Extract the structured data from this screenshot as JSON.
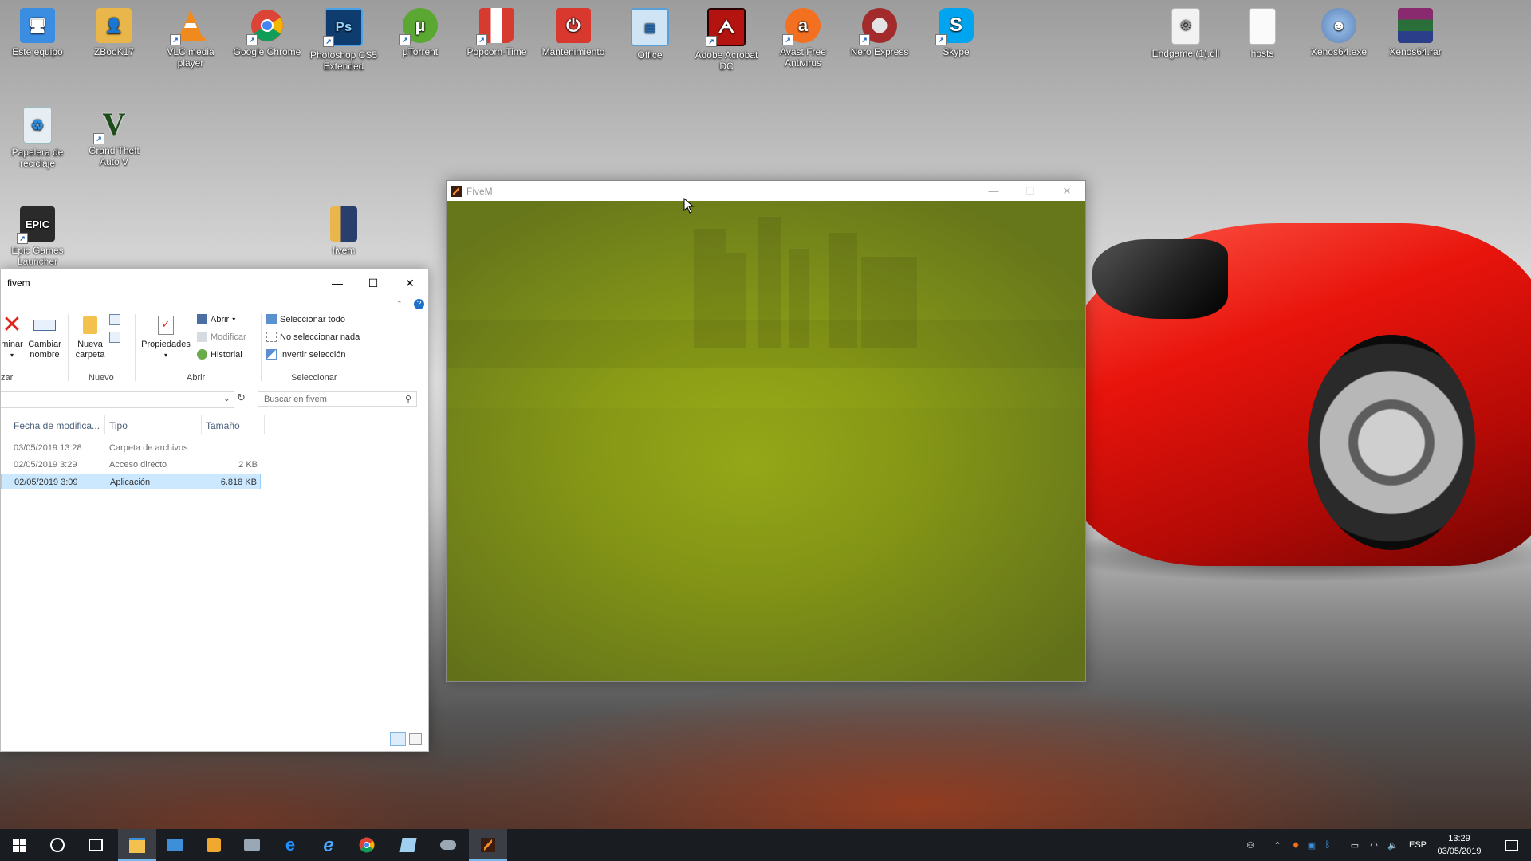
{
  "desktop": {
    "icons_top": [
      {
        "label": "Este equipo",
        "icon": "computer-icon",
        "color": "#3a8de0"
      },
      {
        "label": "ZBooK17",
        "icon": "user-folder-icon",
        "color": "#e8b64a"
      },
      {
        "label": "VLC media player",
        "icon": "vlc-icon",
        "color": "#f08a1c"
      },
      {
        "label": "Google Chrome",
        "icon": "chrome-icon",
        "color": "#2f9e4d"
      },
      {
        "label": "Photoshop CS5 Extended",
        "icon": "photoshop-icon",
        "color": "#1b5e9e"
      },
      {
        "label": "µTorrent",
        "icon": "utorrent-icon",
        "color": "#5aa832"
      },
      {
        "label": "Popcorn-Time",
        "icon": "popcorn-icon",
        "color": "#d63b30"
      },
      {
        "label": "Mantenimiento",
        "icon": "power-icon",
        "color": "#d8382e"
      },
      {
        "label": "Office",
        "icon": "office-icon",
        "color": "#5aa0d8"
      },
      {
        "label": "Adobe Acrobat DC",
        "icon": "acrobat-icon",
        "color": "#b3140f"
      },
      {
        "label": "Avast Free Antivirus",
        "icon": "avast-icon",
        "color": "#f37021"
      },
      {
        "label": "Nero Express",
        "icon": "nero-icon",
        "color": "#a32b2b"
      },
      {
        "label": "Skype",
        "icon": "skype-icon",
        "color": "#00a4ef"
      }
    ],
    "icons_right": [
      {
        "label": "Endgame (1).dll",
        "icon": "dll-file-icon",
        "color": "#e8e8e8"
      },
      {
        "label": "hosts",
        "icon": "file-icon",
        "color": "#f4f4f4"
      },
      {
        "label": "Xenos64.exe",
        "icon": "xenos-exe-icon",
        "color": "#5a7fb5"
      },
      {
        "label": "Xenos64.rar",
        "icon": "winrar-icon",
        "color": "#8a2a6e"
      }
    ],
    "icons_left": [
      {
        "label": "Papelera de reciclaje",
        "icon": "recycle-bin-icon",
        "color": "#d9e6ee"
      },
      {
        "label": "Grand Theft Auto V",
        "icon": "gta-v-icon",
        "color": "#2e6b2a"
      },
      {
        "label": "Epic Games Launcher",
        "icon": "epic-games-icon",
        "color": "#2a2a2a"
      },
      {
        "label": "fivem",
        "icon": "folder-fivem-icon",
        "color": "#e8b64a"
      }
    ]
  },
  "fivem_window": {
    "title": "FiveM",
    "controls": {
      "minimize": "—",
      "maximize": "☐",
      "close": "✕"
    }
  },
  "explorer": {
    "title": "fivem",
    "controls": {
      "minimize": "—",
      "maximize": "☐",
      "close": "✕"
    },
    "ribbon": {
      "eliminar": "minar",
      "cambiar_nombre": "Cambiar nombre",
      "nueva_carpeta": "Nueva carpeta",
      "group_left": "zar",
      "group_nuevo": "Nuevo",
      "propiedades": "Propiedades",
      "abrir": "Abrir",
      "modificar": "Modificar",
      "historial": "Historial",
      "group_abrir": "Abrir",
      "seleccionar_todo": "Seleccionar todo",
      "no_seleccionar": "No seleccionar nada",
      "invertir": "Invertir selección",
      "group_seleccionar": "Seleccionar"
    },
    "search_placeholder": "Buscar en fivem",
    "columns": {
      "fecha": "Fecha de modifica...",
      "tipo": "Tipo",
      "tamano": "Tamaño"
    },
    "rows": [
      {
        "fecha": "03/05/2019 13:28",
        "tipo": "Carpeta de archivos",
        "tamano": ""
      },
      {
        "fecha": "02/05/2019 3:29",
        "tipo": "Acceso directo",
        "tamano": "2 KB"
      },
      {
        "fecha": "02/05/2019 3:09",
        "tipo": "Aplicación",
        "tamano": "6.818 KB"
      }
    ]
  },
  "taskbar": {
    "apps": [
      "file-explorer-icon",
      "control-panel-icon",
      "media-icon",
      "tools-icon",
      "edge-icon",
      "internet-explorer-icon",
      "chrome-icon",
      "office-icon",
      "gamepad-icon",
      "fivem-icon"
    ],
    "language": "ESP",
    "time": "13:29",
    "date": "03/05/2019"
  }
}
